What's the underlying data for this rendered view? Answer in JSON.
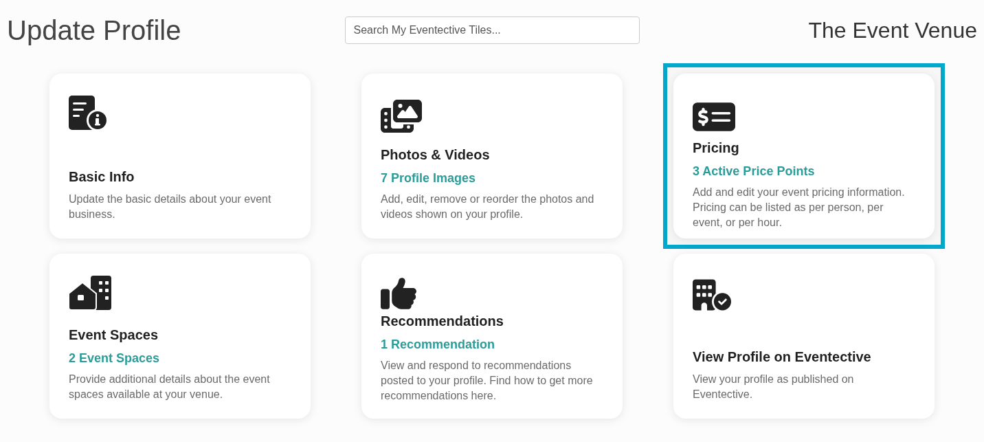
{
  "page_title": "Update Profile",
  "search": {
    "placeholder": "Search My Eventective Tiles..."
  },
  "venue_name": "The Event Venue",
  "tiles": [
    {
      "kind": "info",
      "title": "Basic Info",
      "description": "Update the basic details about your event business.",
      "selected": false
    },
    {
      "kind": "media",
      "title": "Photos & Videos",
      "stat": "7 Profile Images",
      "description": "Add, edit, remove or reorder the photos and videos shown on your profile.",
      "selected": false
    },
    {
      "kind": "pricing",
      "title": "Pricing",
      "stat": "3 Active Price Points",
      "description": "Add and edit your event pricing information. Pricing can be listed as per person, per event, or per hour.",
      "selected": true
    },
    {
      "kind": "spaces",
      "title": "Event Spaces",
      "stat": "2 Event Spaces",
      "description": "Provide additional details about the event spaces available at your venue.",
      "selected": false
    },
    {
      "kind": "recommendations",
      "title": "Recommendations",
      "stat": "1 Recommendation",
      "description": "View and respond to recommendations posted to your profile. Find how to get more recommendations here.",
      "selected": false
    },
    {
      "kind": "profile",
      "title": "View Profile on Eventective",
      "description": "View your profile as published on Eventective.",
      "selected": false
    }
  ]
}
